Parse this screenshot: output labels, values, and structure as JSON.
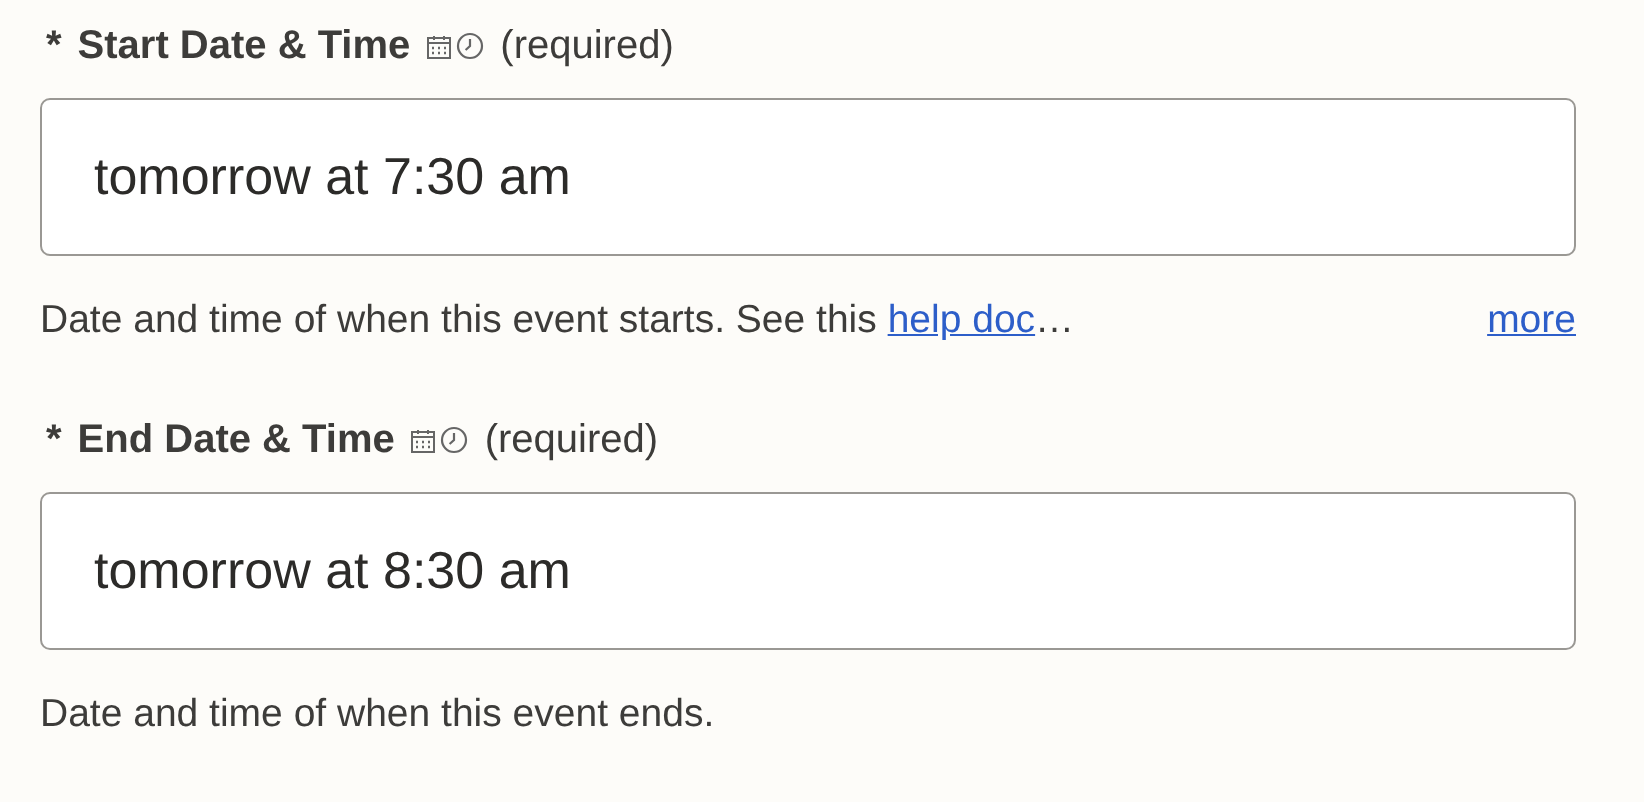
{
  "fields": [
    {
      "marker": "*",
      "label": "Start Date & Time",
      "note": "(required)",
      "value": "tomorrow at 7:30 am",
      "help": {
        "text": "Date and time of when this event starts. See this ",
        "link": "help doc",
        "after": "…"
      },
      "more": "more"
    },
    {
      "marker": "*",
      "label": "End Date & Time",
      "note": "(required)",
      "value": "tomorrow at 8:30 am",
      "help": {
        "text": "Date and time of when this event ends."
      }
    }
  ]
}
